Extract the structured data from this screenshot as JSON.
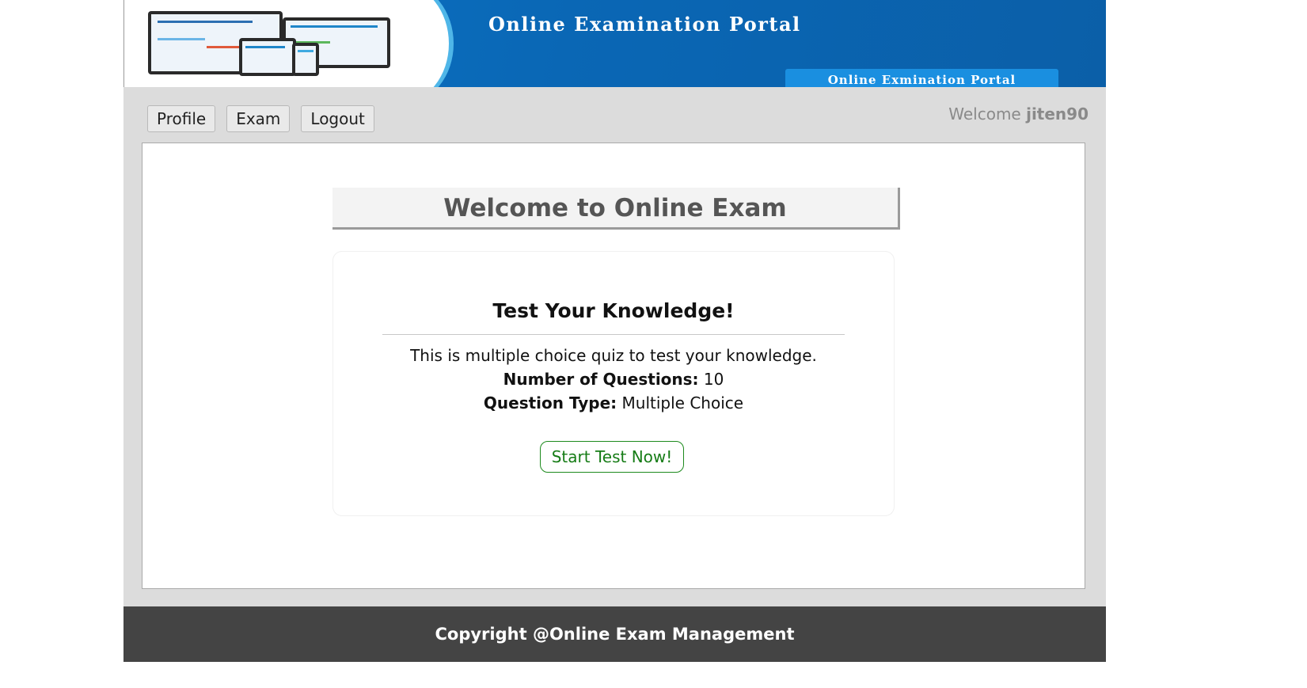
{
  "banner": {
    "title": "Online Examination Portal",
    "subtab": "Online Exmination Portal"
  },
  "nav": {
    "items": [
      {
        "label": "Profile"
      },
      {
        "label": "Exam"
      },
      {
        "label": "Logout"
      }
    ]
  },
  "user": {
    "welcome_prefix": "Welcome",
    "username": "jiten90"
  },
  "main": {
    "heading": "Welcome to Online Exam",
    "card": {
      "title": "Test Your Knowledge!",
      "description": "This is multiple choice quiz to test your knowledge.",
      "questions_label": "Number of Questions:",
      "questions_value": "10",
      "type_label": "Question Type:",
      "type_value": "Multiple Choice",
      "start_label": "Start Test Now!"
    }
  },
  "footer": {
    "text": "Copyright @Online Exam Management"
  },
  "colors": {
    "banner_blue": "#0b6cbc",
    "nav_bg": "#dcdcdc",
    "footer_bg": "#444444",
    "start_green": "#167c16"
  }
}
